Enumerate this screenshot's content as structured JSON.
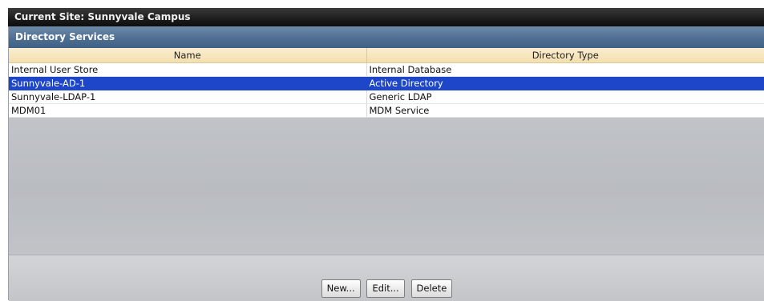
{
  "site_bar": {
    "label": "Current Site:",
    "site_name": "Sunnyvale Campus"
  },
  "panel": {
    "title": "Directory Services"
  },
  "table": {
    "columns": [
      "Name",
      "Directory Type"
    ],
    "rows": [
      {
        "name": "Internal User Store",
        "type": "Internal Database",
        "selected": false
      },
      {
        "name": "Sunnyvale-AD-1",
        "type": "Active Directory",
        "selected": true
      },
      {
        "name": "Sunnyvale-LDAP-1",
        "type": "Generic LDAP",
        "selected": false
      },
      {
        "name": "MDM01",
        "type": "MDM Service",
        "selected": false
      }
    ]
  },
  "buttons": {
    "new": "New...",
    "edit": "Edit...",
    "delete": "Delete"
  },
  "colors": {
    "selection": "#1e46c8",
    "header_bg": "#f3dfae",
    "title_bar": "#4f6f92"
  }
}
